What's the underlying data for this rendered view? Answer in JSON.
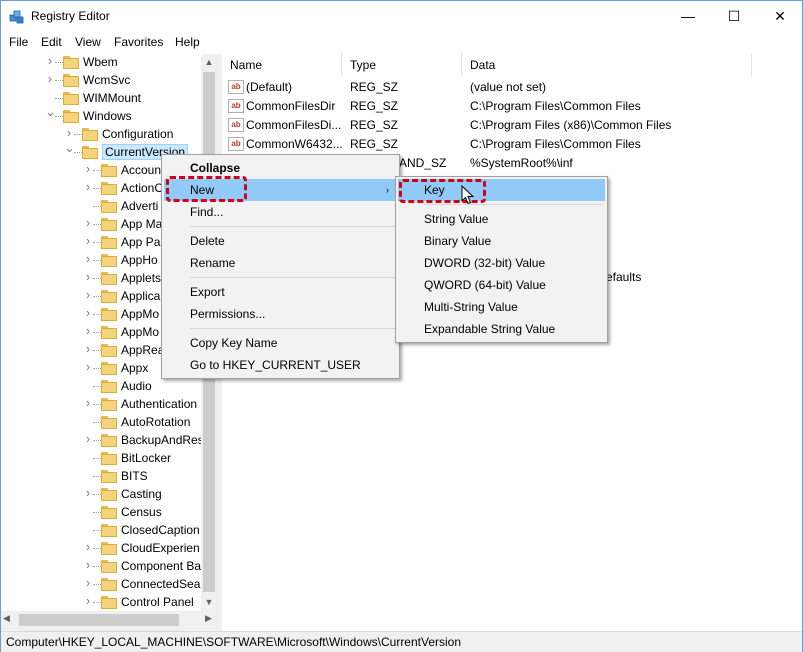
{
  "window": {
    "title": "Registry Editor",
    "icon": "registry-editor-icon",
    "controls": {
      "minimize": "—",
      "maximize": "☐",
      "close": "✕"
    }
  },
  "menubar": [
    "File",
    "Edit",
    "View",
    "Favorites",
    "Help"
  ],
  "tree": [
    {
      "label": "Wbem",
      "level": 2,
      "expander": "collapsed"
    },
    {
      "label": "WcmSvc",
      "level": 2,
      "expander": "collapsed"
    },
    {
      "label": "WIMMount",
      "level": 2,
      "expander": "none"
    },
    {
      "label": "Windows",
      "level": 2,
      "expander": "expanded"
    },
    {
      "label": "Configuration",
      "level": 3,
      "expander": "collapsed"
    },
    {
      "label": "CurrentVersion",
      "level": 3,
      "expander": "expanded",
      "selected": true
    },
    {
      "label": "Accoun",
      "level": 4,
      "expander": "collapsed"
    },
    {
      "label": "ActionC",
      "level": 4,
      "expander": "collapsed"
    },
    {
      "label": "Adverti",
      "level": 4,
      "expander": "none"
    },
    {
      "label": "App Ma",
      "level": 4,
      "expander": "collapsed"
    },
    {
      "label": "App Pa",
      "level": 4,
      "expander": "collapsed"
    },
    {
      "label": "AppHo",
      "level": 4,
      "expander": "collapsed"
    },
    {
      "label": "Applets",
      "level": 4,
      "expander": "collapsed"
    },
    {
      "label": "Applica",
      "level": 4,
      "expander": "collapsed"
    },
    {
      "label": "AppMo",
      "level": 4,
      "expander": "collapsed"
    },
    {
      "label": "AppMo",
      "level": 4,
      "expander": "collapsed"
    },
    {
      "label": "AppRea",
      "level": 4,
      "expander": "collapsed"
    },
    {
      "label": "Appx",
      "level": 4,
      "expander": "collapsed"
    },
    {
      "label": "Audio",
      "level": 4,
      "expander": "none"
    },
    {
      "label": "Authentication",
      "level": 4,
      "expander": "collapsed"
    },
    {
      "label": "AutoRotation",
      "level": 4,
      "expander": "none"
    },
    {
      "label": "BackupAndRes",
      "level": 4,
      "expander": "collapsed"
    },
    {
      "label": "BitLocker",
      "level": 4,
      "expander": "none"
    },
    {
      "label": "BITS",
      "level": 4,
      "expander": "none"
    },
    {
      "label": "Casting",
      "level": 4,
      "expander": "collapsed"
    },
    {
      "label": "Census",
      "level": 4,
      "expander": "none"
    },
    {
      "label": "ClosedCaption",
      "level": 4,
      "expander": "none"
    },
    {
      "label": "CloudExperien",
      "level": 4,
      "expander": "collapsed"
    },
    {
      "label": "Component Ba",
      "level": 4,
      "expander": "collapsed"
    },
    {
      "label": "ConnectedSear",
      "level": 4,
      "expander": "collapsed"
    },
    {
      "label": "Control Panel",
      "level": 4,
      "expander": "collapsed"
    }
  ],
  "values": {
    "headers": {
      "name": "Name",
      "type": "Type",
      "data": "Data"
    },
    "rows": [
      {
        "name": "(Default)",
        "type": "REG_SZ",
        "data": "(value not set)",
        "icon": "ab"
      },
      {
        "name": "CommonFilesDir",
        "type": "REG_SZ",
        "data": "C:\\Program Files\\Common Files",
        "icon": "ab"
      },
      {
        "name": "CommonFilesDi...",
        "type": "REG_SZ",
        "data": "C:\\Program Files (x86)\\Common Files",
        "icon": "ab"
      },
      {
        "name": "CommonW6432...",
        "type": "REG_SZ",
        "data": "C:\\Program Files\\Common Files",
        "icon": "ab"
      },
      {
        "name": "",
        "type": "AND_SZ",
        "data": "%SystemRoot%\\inf",
        "icon": ""
      }
    ],
    "partial_text": "efaults"
  },
  "context_menu": {
    "items": [
      "Collapse",
      "New",
      "Find...",
      "Delete",
      "Rename",
      "Export",
      "Permissions...",
      "Copy Key Name",
      "Go to HKEY_CURRENT_USER"
    ],
    "submenu_arrow": "›"
  },
  "submenu": {
    "items": [
      "Key",
      "String Value",
      "Binary Value",
      "DWORD (32-bit) Value",
      "QWORD (64-bit) Value",
      "Multi-String Value",
      "Expandable String Value"
    ]
  },
  "statusbar": {
    "path": "Computer\\HKEY_LOCAL_MACHINE\\SOFTWARE\\Microsoft\\Windows\\CurrentVersion"
  },
  "colors": {
    "highlight": "#91c9f7",
    "selection": "#cce8ff",
    "annotation": "#d0021b",
    "folder": "#f4d47a"
  }
}
